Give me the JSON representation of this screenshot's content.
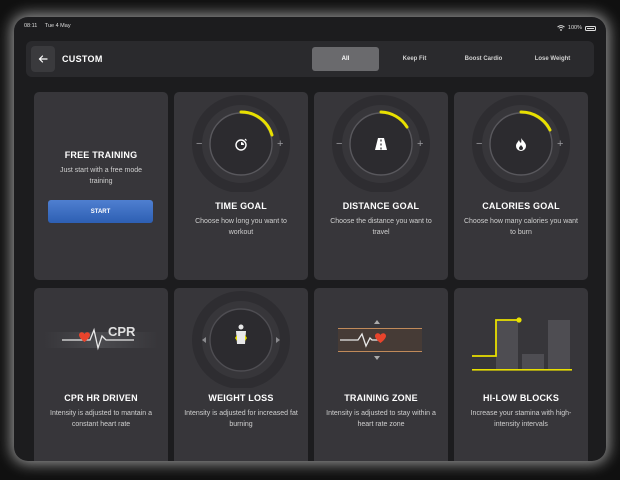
{
  "status_bar": {
    "time": "08:11",
    "date": "Tue 4 May",
    "battery": "100%"
  },
  "header": {
    "title": "CUSTOM"
  },
  "tabs": [
    {
      "label": "All",
      "active": true
    },
    {
      "label": "Keep Fit",
      "active": false
    },
    {
      "label": "Boost Cardio",
      "active": false
    },
    {
      "label": "Lose Weight",
      "active": false
    }
  ],
  "cards": {
    "free": {
      "title": "FREE TRAINING",
      "desc": "Just start with a free mode training",
      "button": "START"
    },
    "time": {
      "title": "TIME GOAL",
      "desc": "Choose how long you want to workout",
      "minus": "−",
      "plus": "+"
    },
    "distance": {
      "title": "DISTANCE GOAL",
      "desc": "Choose the distance you want to travel",
      "minus": "−",
      "plus": "+"
    },
    "calories": {
      "title": "CALORIES GOAL",
      "desc": "Choose how many calories you want to burn",
      "minus": "−",
      "plus": "+"
    },
    "cpr": {
      "title": "CPR HR DRIVEN",
      "desc": "Intensity is adjusted to mantain a constant heart rate",
      "label": "CPR"
    },
    "weight": {
      "title": "WEIGHT LOSS",
      "desc": "Intensity is adjusted for increased fat burning"
    },
    "zone": {
      "title": "TRAINING ZONE",
      "desc": "Intensity is adjusted to stay within a heart rate zone"
    },
    "hilo": {
      "title": "HI-LOW BLOCKS",
      "desc": "Increase your stamina with high-intensity intervals"
    }
  },
  "colors": {
    "accent_yellow": "#e8e000",
    "heart_red": "#e8442c",
    "button_blue": "#3a6cc2"
  },
  "icons": [
    "back-arrow-icon",
    "wifi-icon",
    "battery-icon",
    "stopwatch-icon",
    "road-icon",
    "flame-icon",
    "heart-icon",
    "body-icon"
  ]
}
